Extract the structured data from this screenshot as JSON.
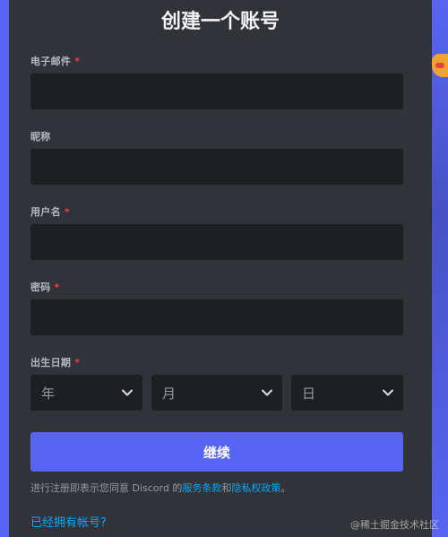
{
  "form": {
    "title": "创建一个账号",
    "email_label": "电子邮件",
    "nickname_label": "昵称",
    "username_label": "用户名",
    "password_label": "密码",
    "birth_label": "出生日期",
    "required_mark": "*",
    "email_value": "",
    "nickname_value": "",
    "username_value": "",
    "password_value": "",
    "year_placeholder": "年",
    "month_placeholder": "月",
    "day_placeholder": "日",
    "continue_label": "继续",
    "terms_prefix": "进行注册即表示您同意 Discord 的",
    "terms_link": "服务条款",
    "terms_and": "和",
    "privacy_link": "隐私权政策",
    "terms_suffix": "。",
    "login_link": "已经拥有帐号?"
  },
  "watermark": "@稀土掘金技术社区",
  "colors": {
    "background": "#5865f2",
    "panel": "#313338",
    "input": "#1e1f22",
    "accent": "#5865f2",
    "link": "#00a8fc",
    "required": "#f23f42"
  },
  "icons": {
    "select_arrow": "chevron-down-icon"
  }
}
